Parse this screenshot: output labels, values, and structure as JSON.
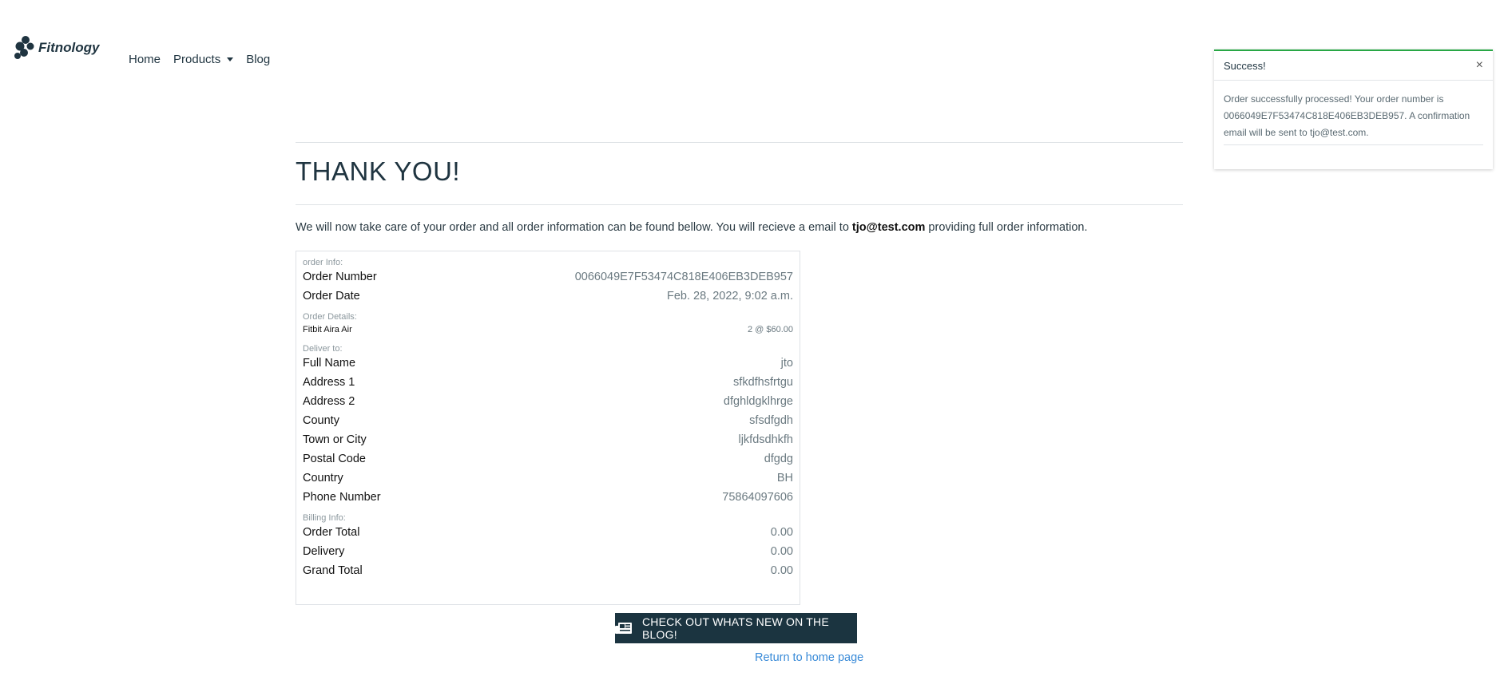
{
  "brand": {
    "name": "Fitnology"
  },
  "nav": {
    "home": "Home",
    "products": "Products",
    "blog": "Blog"
  },
  "toast": {
    "title": "Success!",
    "close": "×",
    "line1": "Order successfully processed! Your order number is",
    "line2": "0066049E7F53474C818E406EB3DEB957. A confirmation",
    "line3": "email will be sent to tjo@test.com."
  },
  "page": {
    "title": "THANK YOU!",
    "intro_before": "We will now take care of your order and all order information can be found bellow. You will recieve a email to ",
    "intro_email": "tjo@test.com",
    "intro_after": " providing full order information."
  },
  "order": {
    "info_heading": "order Info:",
    "number_label": "Order Number",
    "number_value": "0066049E7F53474C818E406EB3DEB957",
    "date_label": "Order Date",
    "date_value": "Feb. 28, 2022, 9:02 a.m.",
    "details_heading": "Order Details:",
    "item_name": "Fitbit Aira Air",
    "item_qty": "2 @ $60.00",
    "deliver_heading": "Deliver to:",
    "delivery": [
      {
        "label": "Full Name",
        "value": "jto"
      },
      {
        "label": "Address 1",
        "value": "sfkdfhsfrtgu"
      },
      {
        "label": "Address 2",
        "value": "dfghldgklhrge"
      },
      {
        "label": "County",
        "value": "sfsdfgdh"
      },
      {
        "label": "Town or City",
        "value": "ljkfdsdhkfh"
      },
      {
        "label": "Postal Code",
        "value": "dfgdg"
      },
      {
        "label": "Country",
        "value": "BH"
      },
      {
        "label": "Phone Number",
        "value": "75864097606"
      }
    ],
    "billing_heading": "Billing Info:",
    "billing": [
      {
        "label": "Order Total",
        "value": "0.00"
      },
      {
        "label": "Delivery",
        "value": "0.00"
      },
      {
        "label": "Grand Total",
        "value": "0.00"
      }
    ]
  },
  "actions": {
    "blog_button": "CHECK OUT WHATS NEW ON THE BLOG!",
    "home_link": "Return to home page"
  },
  "colors": {
    "primary": "#1b3440",
    "success": "#28a745",
    "link": "#3a8bd8"
  }
}
